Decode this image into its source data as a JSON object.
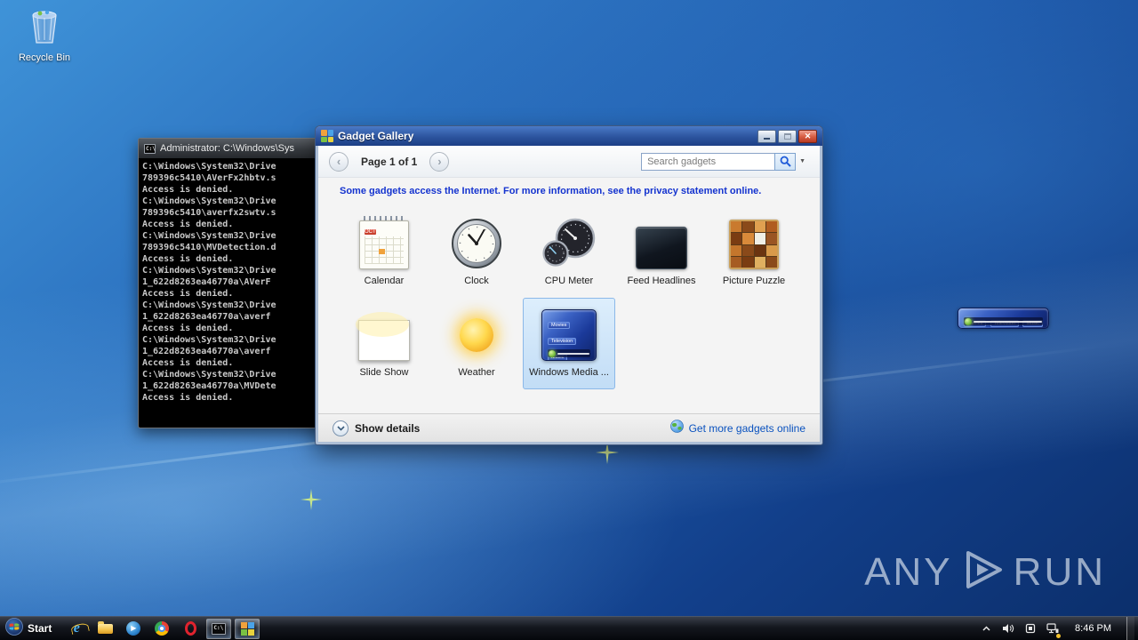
{
  "theme": {
    "titlebar_blue": "#2c549e",
    "selection_blue": "#c2ddf6",
    "info_blue": "#1433cf",
    "link_blue": "#0a52bf",
    "desktop_blue": "#1d57a8"
  },
  "desktop": {
    "recycle_bin_label": "Recycle Bin",
    "watermark_left": "ANY",
    "watermark_right": "RUN"
  },
  "cmd_window": {
    "title": "Administrator: C:\\Windows\\Sys",
    "output_lines": [
      "C:\\Windows\\System32\\Drive",
      "789396c5410\\AVerFx2hbtv.s",
      "Access is denied.",
      "C:\\Windows\\System32\\Drive",
      "789396c5410\\averfx2swtv.s",
      "Access is denied.",
      "C:\\Windows\\System32\\Drive",
      "789396c5410\\MVDetection.d",
      "Access is denied.",
      "C:\\Windows\\System32\\Drive",
      "1_622d8263ea46770a\\AVerF",
      "Access is denied.",
      "C:\\Windows\\System32\\Drive",
      "1_622d8263ea46770a\\averf",
      "Access is denied.",
      "C:\\Windows\\System32\\Drive",
      "1_622d8263ea46770a\\averf",
      "Access is denied.",
      "C:\\Windows\\System32\\Drive",
      "1_622d8263ea46770a\\MVDete",
      "Access is denied."
    ]
  },
  "gadget_gallery": {
    "title": "Gadget Gallery",
    "page_label": "Page 1 of 1",
    "search_placeholder": "Search gadgets",
    "info_text": "Some gadgets access the Internet.  For more information, see the privacy statement online.",
    "gadgets": [
      {
        "name": "Calendar"
      },
      {
        "name": "Clock"
      },
      {
        "name": "CPU Meter"
      },
      {
        "name": "Feed Headlines"
      },
      {
        "name": "Picture Puzzle"
      },
      {
        "name": "Slide Show"
      },
      {
        "name": "Weather"
      },
      {
        "name": "Windows Media ...",
        "selected": true
      }
    ],
    "show_details_label": "Show details",
    "get_more_label": "Get more gadgets online"
  },
  "media_gadget": {
    "lines": [
      "Movies",
      "Television",
      "Music"
    ]
  },
  "taskbar": {
    "start_label": "Start",
    "clock": "8:46 PM"
  }
}
